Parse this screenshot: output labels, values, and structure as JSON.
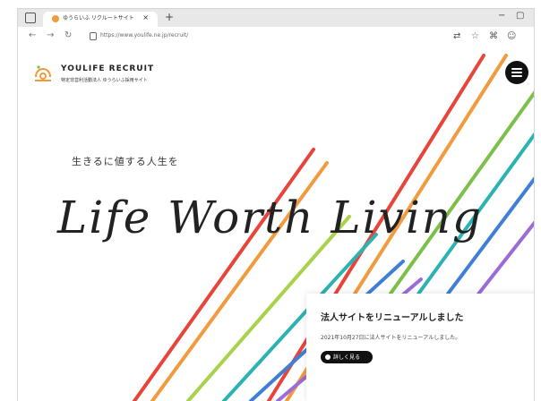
{
  "browser": {
    "tab_title": "ゆうらいふ リクルートサイト",
    "tab_close": "×",
    "new_tab": "+",
    "url": "https://www.youlife.ne.jp/recruit/",
    "window_minimize": "−",
    "window_restore": "▢"
  },
  "site": {
    "brand": "YOULIFE RECRUIT",
    "brand_sub": "特定非営利活動法人 ゆうらいふ採用サイト",
    "tagline_jp": "生きるに値する人生を",
    "tagline_en": "Life Worth Living"
  },
  "news": {
    "headline": "法人サイトをリニューアルしました",
    "date_text": "2021年10月27日に法人サイトをリニューアルしました。",
    "button_label": "詳しく見る"
  },
  "colors": {
    "stripe_red": "#e8443a",
    "stripe_orange": "#f19a3e",
    "stripe_green": "#7cc04a",
    "stripe_teal": "#2bb3b1",
    "stripe_blue": "#3f7fd6",
    "stripe_purple": "#9b6bd6",
    "stripe_lime": "#a8d24a"
  }
}
